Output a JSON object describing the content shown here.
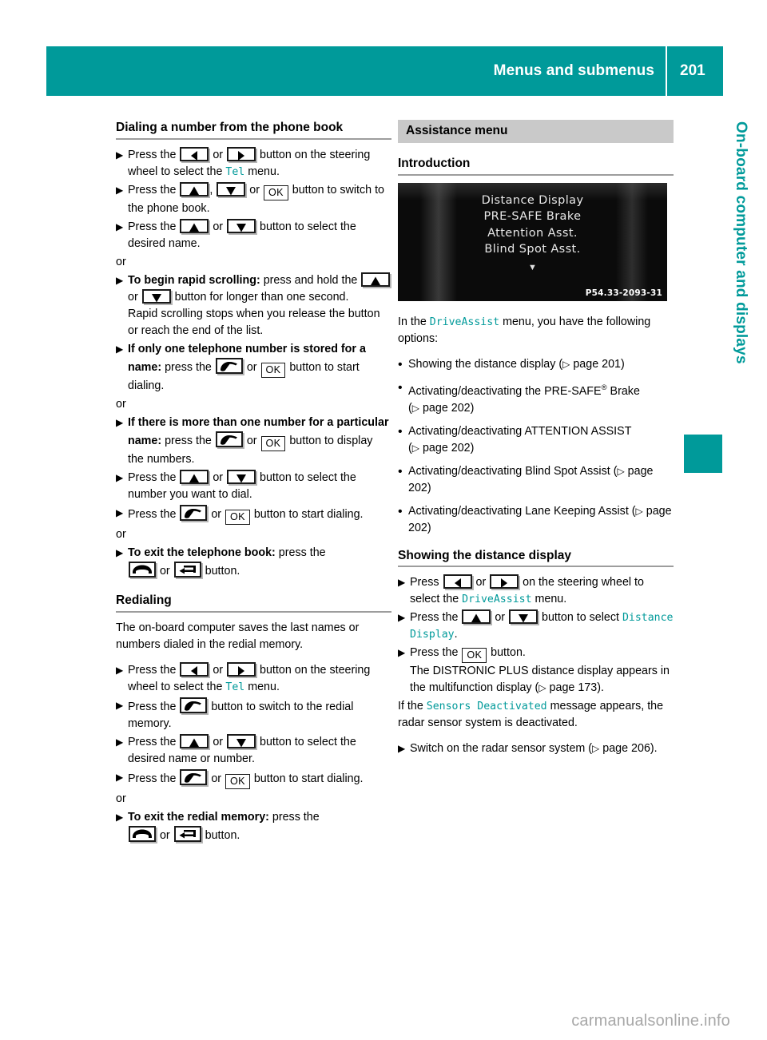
{
  "header": {
    "title": "Menus and submenus",
    "page_number": "201",
    "accent_color": "#009a9a"
  },
  "side_tab": {
    "label": "On-board computer and displays"
  },
  "footer": {
    "watermark": "carmanualsonline.info"
  },
  "icons": {
    "left_arrow": "left-arrow-button",
    "right_arrow": "right-arrow-button",
    "up_arrow": "up-arrow-button",
    "down_arrow": "down-arrow-button",
    "ok": "OK",
    "call": "call-handset-button",
    "hangup": "hangup-handset-button",
    "back": "back-arrow-button",
    "page_ref": "▷",
    "step_marker": "▶",
    "bullet_dot": "•"
  },
  "left_column": {
    "heading_dialing": "Dialing a number from the phone book",
    "steps_dialing": [
      {
        "parts": [
          {
            "t": "text",
            "v": "Press the "
          },
          {
            "t": "key",
            "v": "left_arrow"
          },
          {
            "t": "text",
            "v": " or "
          },
          {
            "t": "key",
            "v": "right_arrow"
          },
          {
            "t": "text",
            "v": " button on the steering wheel to select the "
          },
          {
            "t": "mono",
            "v": "Tel"
          },
          {
            "t": "text",
            "v": " menu."
          }
        ]
      },
      {
        "parts": [
          {
            "t": "text",
            "v": "Press the "
          },
          {
            "t": "key",
            "v": "up_arrow"
          },
          {
            "t": "text",
            "v": ", "
          },
          {
            "t": "key",
            "v": "down_arrow"
          },
          {
            "t": "text",
            "v": " or "
          },
          {
            "t": "key",
            "v": "ok"
          },
          {
            "t": "text",
            "v": " button to switch to the phone book."
          }
        ]
      },
      {
        "parts": [
          {
            "t": "text",
            "v": "Press the "
          },
          {
            "t": "key",
            "v": "up_arrow"
          },
          {
            "t": "text",
            "v": " or "
          },
          {
            "t": "key",
            "v": "down_arrow"
          },
          {
            "t": "text",
            "v": " button to select the desired name."
          }
        ]
      }
    ],
    "or_1": "or",
    "steps_rapid": [
      {
        "parts": [
          {
            "t": "bold",
            "v": "To begin rapid scrolling:"
          },
          {
            "t": "text",
            "v": " press and hold the "
          },
          {
            "t": "key",
            "v": "up_arrow"
          },
          {
            "t": "text",
            "v": " or "
          },
          {
            "t": "key",
            "v": "down_arrow"
          },
          {
            "t": "text",
            "v": " button for longer than one second."
          },
          {
            "t": "break",
            "v": ""
          },
          {
            "t": "text",
            "v": "Rapid scrolling stops when you release the button or reach the end of the list."
          }
        ]
      },
      {
        "parts": [
          {
            "t": "bold",
            "v": "If only one telephone number is stored for a name:"
          },
          {
            "t": "text",
            "v": " press the "
          },
          {
            "t": "key",
            "v": "call"
          },
          {
            "t": "text",
            "v": " or "
          },
          {
            "t": "key",
            "v": "ok"
          },
          {
            "t": "text",
            "v": " button to start dialing."
          }
        ]
      }
    ],
    "or_2": "or",
    "steps_multi": [
      {
        "parts": [
          {
            "t": "bold",
            "v": "If there is more than one number for a particular name:"
          },
          {
            "t": "text",
            "v": " press the "
          },
          {
            "t": "key",
            "v": "call"
          },
          {
            "t": "text",
            "v": " or "
          },
          {
            "t": "key",
            "v": "ok"
          },
          {
            "t": "text",
            "v": " button to display the numbers."
          }
        ]
      },
      {
        "parts": [
          {
            "t": "text",
            "v": "Press the "
          },
          {
            "t": "key",
            "v": "up_arrow"
          },
          {
            "t": "text",
            "v": " or "
          },
          {
            "t": "key",
            "v": "down_arrow"
          },
          {
            "t": "text",
            "v": " button to select the number you want to dial."
          }
        ]
      },
      {
        "parts": [
          {
            "t": "text",
            "v": "Press the "
          },
          {
            "t": "key",
            "v": "call"
          },
          {
            "t": "text",
            "v": " or "
          },
          {
            "t": "key",
            "v": "ok"
          },
          {
            "t": "text",
            "v": " button to start dialing."
          }
        ]
      }
    ],
    "or_3": "or",
    "steps_exit_phonebook": [
      {
        "parts": [
          {
            "t": "bold",
            "v": "To exit the telephone book:"
          },
          {
            "t": "text",
            "v": " press the "
          },
          {
            "t": "break",
            "v": ""
          },
          {
            "t": "key",
            "v": "hangup"
          },
          {
            "t": "text",
            "v": " or "
          },
          {
            "t": "key",
            "v": "back"
          },
          {
            "t": "text",
            "v": " button."
          }
        ]
      }
    ],
    "heading_redialing": "Redialing",
    "redialing_intro": "The on-board computer saves the last names or numbers dialed in the redial memory.",
    "steps_redial": [
      {
        "parts": [
          {
            "t": "text",
            "v": "Press the "
          },
          {
            "t": "key",
            "v": "left_arrow"
          },
          {
            "t": "text",
            "v": " or "
          },
          {
            "t": "key",
            "v": "right_arrow"
          },
          {
            "t": "text",
            "v": " button on the steering wheel to select the "
          },
          {
            "t": "mono",
            "v": "Tel"
          },
          {
            "t": "text",
            "v": " menu."
          }
        ]
      },
      {
        "parts": [
          {
            "t": "text",
            "v": "Press the "
          },
          {
            "t": "key",
            "v": "call"
          },
          {
            "t": "text",
            "v": " button to switch to the redial memory."
          }
        ]
      },
      {
        "parts": [
          {
            "t": "text",
            "v": "Press the "
          },
          {
            "t": "key",
            "v": "up_arrow"
          },
          {
            "t": "text",
            "v": " or "
          },
          {
            "t": "key",
            "v": "down_arrow"
          },
          {
            "t": "text",
            "v": " button to select the desired name or number."
          }
        ]
      },
      {
        "parts": [
          {
            "t": "text",
            "v": "Press the "
          },
          {
            "t": "key",
            "v": "call"
          },
          {
            "t": "text",
            "v": " or "
          },
          {
            "t": "key",
            "v": "ok"
          },
          {
            "t": "text",
            "v": " button to start dialing."
          }
        ]
      }
    ],
    "or_4": "or",
    "steps_exit_redial": [
      {
        "parts": [
          {
            "t": "bold",
            "v": "To exit the redial memory:"
          },
          {
            "t": "text",
            "v": " press the "
          },
          {
            "t": "break",
            "v": ""
          },
          {
            "t": "key",
            "v": "hangup"
          },
          {
            "t": "text",
            "v": " or "
          },
          {
            "t": "key",
            "v": "back"
          },
          {
            "t": "text",
            "v": " button."
          }
        ]
      }
    ]
  },
  "right_column": {
    "section_bar": "Assistance menu",
    "heading_introduction": "Introduction",
    "figure": {
      "menu_items": [
        "Distance Display",
        "PRE-SAFE Brake",
        "Attention Asst.",
        "Blind Spot Asst."
      ],
      "scroll_indicator": "▼",
      "code": "P54.33-2093-31"
    },
    "intro_parts": [
      {
        "t": "text",
        "v": "In the "
      },
      {
        "t": "mono",
        "v": "DriveAssist"
      },
      {
        "t": "text",
        "v": " menu, you have the following options:"
      }
    ],
    "options": [
      {
        "parts": [
          {
            "t": "text",
            "v": "Showing the distance display ("
          },
          {
            "t": "ref",
            "v": "page 201"
          },
          {
            "t": "text",
            "v": ")"
          }
        ]
      },
      {
        "parts": [
          {
            "t": "text",
            "v": "Activating/deactivating the PRE-SAFE"
          },
          {
            "t": "sup",
            "v": "®"
          },
          {
            "t": "text",
            "v": " Brake ("
          },
          {
            "t": "ref",
            "v": "page 202"
          },
          {
            "t": "text",
            "v": ")"
          }
        ]
      },
      {
        "parts": [
          {
            "t": "text",
            "v": "Activating/deactivating ATTENTION ASSIST ("
          },
          {
            "t": "ref",
            "v": "page 202"
          },
          {
            "t": "text",
            "v": ")"
          }
        ]
      },
      {
        "parts": [
          {
            "t": "text",
            "v": "Activating/deactivating Blind Spot Assist ("
          },
          {
            "t": "ref",
            "v": "page 202"
          },
          {
            "t": "text",
            "v": ")"
          }
        ]
      },
      {
        "parts": [
          {
            "t": "text",
            "v": "Activating/deactivating Lane Keeping Assist ("
          },
          {
            "t": "ref",
            "v": "page 202"
          },
          {
            "t": "text",
            "v": ")"
          }
        ]
      }
    ],
    "heading_distance": "Showing the distance display",
    "steps_distance": [
      {
        "parts": [
          {
            "t": "text",
            "v": "Press "
          },
          {
            "t": "key",
            "v": "left_arrow"
          },
          {
            "t": "text",
            "v": " or "
          },
          {
            "t": "key",
            "v": "right_arrow"
          },
          {
            "t": "text",
            "v": " on the steering wheel to select the "
          },
          {
            "t": "mono",
            "v": "DriveAssist"
          },
          {
            "t": "text",
            "v": " menu."
          }
        ]
      },
      {
        "parts": [
          {
            "t": "text",
            "v": "Press the "
          },
          {
            "t": "key",
            "v": "up_arrow"
          },
          {
            "t": "text",
            "v": " or "
          },
          {
            "t": "key",
            "v": "down_arrow"
          },
          {
            "t": "text",
            "v": " button to select "
          },
          {
            "t": "mono",
            "v": "Distance Display"
          },
          {
            "t": "text",
            "v": "."
          }
        ]
      },
      {
        "parts": [
          {
            "t": "text",
            "v": "Press the "
          },
          {
            "t": "key",
            "v": "ok"
          },
          {
            "t": "text",
            "v": " button."
          },
          {
            "t": "break",
            "v": ""
          },
          {
            "t": "text",
            "v": "The DISTRONIC PLUS distance display appears in the multifunction display ("
          },
          {
            "t": "ref",
            "v": "page 173"
          },
          {
            "t": "text",
            "v": ")."
          }
        ]
      }
    ],
    "sensors_parts": [
      {
        "t": "text",
        "v": "If the "
      },
      {
        "t": "mono",
        "v": "Sensors Deactivated"
      },
      {
        "t": "text",
        "v": " message appears, the radar sensor system is deactivated."
      }
    ],
    "steps_sensors": [
      {
        "parts": [
          {
            "t": "text",
            "v": "Switch on the radar sensor system ("
          },
          {
            "t": "ref",
            "v": "page 206"
          },
          {
            "t": "text",
            "v": ")."
          }
        ]
      }
    ]
  }
}
